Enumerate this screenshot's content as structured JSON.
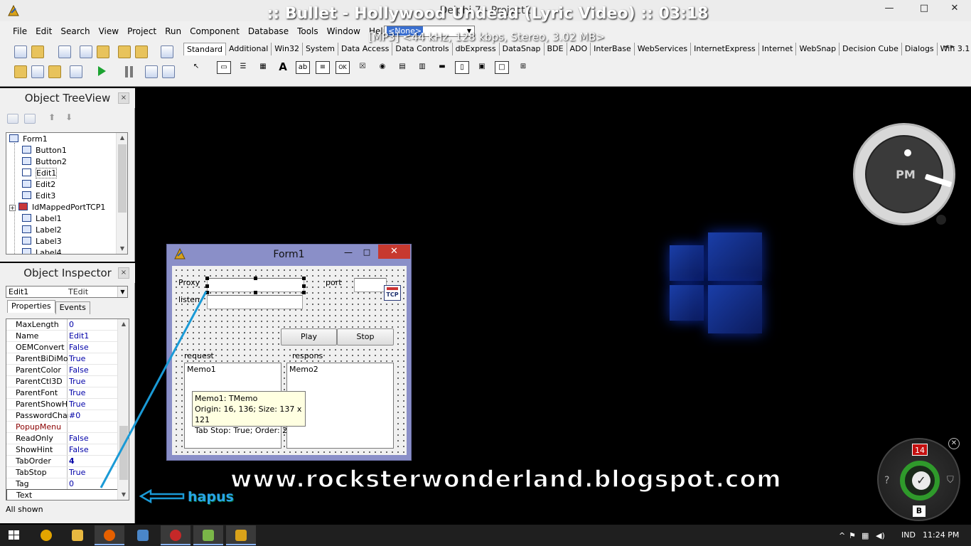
{
  "media": {
    "title": ":: Bullet - Hollywood Undead (Lyric Video) :: 03:18",
    "info": "[MP3] <44 kHz, 128 kbps, Stereo, 3.02 MB>"
  },
  "ide": {
    "window_title": "Delphi 7 - Project1",
    "window_controls": {
      "minimize": "—",
      "maximize": "□",
      "close": "✕"
    },
    "menu": [
      "File",
      "Edit",
      "Search",
      "View",
      "Project",
      "Run",
      "Component",
      "Database",
      "Tools",
      "Window",
      "Help"
    ],
    "config_combo": "<None>",
    "palette_tabs": [
      "Standard",
      "Additional",
      "Win32",
      "System",
      "Data Access",
      "Data Controls",
      "dbExpress",
      "DataSnap",
      "BDE",
      "ADO",
      "InterBase",
      "WebServices",
      "InternetExpress",
      "Internet",
      "WebSnap",
      "Decision Cube",
      "Dialogs",
      "Win 3.1"
    ],
    "palette_arrows": "◄ ►",
    "component_glyphs": [
      "↖",
      "▭",
      "☰",
      "▦",
      "A",
      "ab",
      "≡",
      "OK",
      "☒",
      "◉",
      "▤",
      "▥",
      "▬",
      "▯",
      "▣",
      "□",
      "⊞"
    ]
  },
  "tree_view": {
    "title": "Object TreeView",
    "close": "×",
    "nodes": [
      {
        "label": "Form1",
        "root": true
      },
      {
        "label": "Button1"
      },
      {
        "label": "Button2"
      },
      {
        "label": "Edit1",
        "selected": true
      },
      {
        "label": "Edit2"
      },
      {
        "label": "Edit3"
      },
      {
        "label": "IdMappedPortTCP1",
        "expandable": true
      },
      {
        "label": "Label1"
      },
      {
        "label": "Label2"
      },
      {
        "label": "Label3"
      },
      {
        "label": "Label4"
      }
    ],
    "scroll_up": "▲",
    "scroll_down": "▼"
  },
  "inspector": {
    "title": "Object Inspector",
    "close": "×",
    "selected_object": "Edit1",
    "selected_type": "TEdit",
    "combo_arrow": "▼",
    "tabs": [
      "Properties",
      "Events"
    ],
    "properties": [
      {
        "name": "MaxLength",
        "value": "0"
      },
      {
        "name": "Name",
        "value": "Edit1"
      },
      {
        "name": "OEMConvert",
        "value": "False"
      },
      {
        "name": "ParentBiDiMode",
        "value": "True"
      },
      {
        "name": "ParentColor",
        "value": "False"
      },
      {
        "name": "ParentCtl3D",
        "value": "True"
      },
      {
        "name": "ParentFont",
        "value": "True"
      },
      {
        "name": "ParentShowHint",
        "value": "True"
      },
      {
        "name": "PasswordChar",
        "value": "#0"
      },
      {
        "name": "PopupMenu",
        "value": "",
        "event": true
      },
      {
        "name": "ReadOnly",
        "value": "False"
      },
      {
        "name": "ShowHint",
        "value": "False"
      },
      {
        "name": "TabOrder",
        "value": "4",
        "bold": true
      },
      {
        "name": "TabStop",
        "value": "True"
      },
      {
        "name": "Tag",
        "value": "0"
      },
      {
        "name": "Text",
        "value": "",
        "selected": true
      }
    ],
    "status": "All shown",
    "scroll_up": "▲",
    "scroll_down": "▼"
  },
  "form1": {
    "caption": "Form1",
    "min": "—",
    "max": "□",
    "close": "✕",
    "labels": {
      "proxy": "Proxy",
      "port": "port",
      "listen": "listen",
      "request": "request",
      "respons": "respons"
    },
    "buttons": {
      "play": "Play",
      "stop": "Stop"
    },
    "memo1": "Memo1",
    "memo2": "Memo2",
    "tcp_icon": "TCP",
    "tooltip": [
      "Memo1: TMemo",
      "Origin: 16, 136; Size: 137 x 121",
      "Tab Stop: True; Order: 2"
    ]
  },
  "annotation": {
    "watermark": "www.rocksterwonderland.blogspot.com",
    "hapus_label": "hapus",
    "accent": "#1a9ad6"
  },
  "clock_gadget": {
    "ampm": "PM"
  },
  "security_gadget": {
    "badge": "14",
    "key": "B",
    "check": "✓",
    "help": "?",
    "shield": "⛉",
    "close": "✕"
  },
  "taskbar": {
    "language": "IND",
    "time": "11:24 PM",
    "items": [
      {
        "name": "taskbar-search-icon",
        "color": "#e2a400"
      },
      {
        "name": "taskbar-explorer-icon",
        "color": "#e8b840"
      },
      {
        "name": "taskbar-firefox-icon",
        "color": "#e66000",
        "active": true
      },
      {
        "name": "taskbar-network-icon",
        "color": "#4a86c8"
      },
      {
        "name": "taskbar-blocked-icon",
        "color": "#c62828"
      },
      {
        "name": "taskbar-media-icon",
        "color": "#7ab648"
      },
      {
        "name": "taskbar-delphi-icon",
        "color": "#d9a21a",
        "active": true
      }
    ],
    "tray_icons": [
      "^",
      "⚑",
      "▦",
      "◀)"
    ]
  }
}
